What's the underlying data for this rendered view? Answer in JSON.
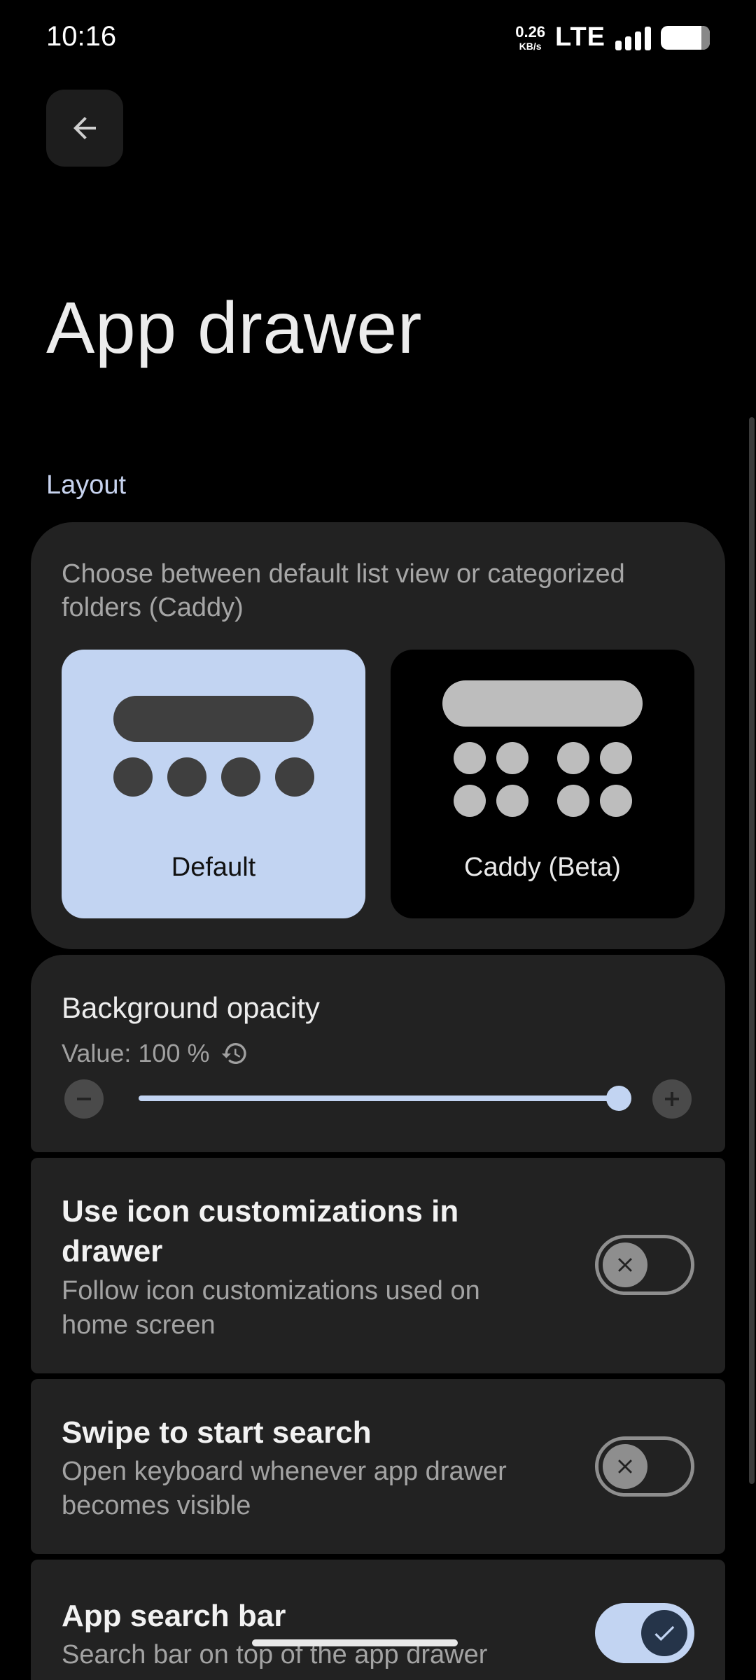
{
  "status_bar": {
    "time": "10:16",
    "net_speed_value": "0.26",
    "net_speed_unit": "KB/s",
    "network": "LTE",
    "signal_icon": "signal-bars-icon",
    "battery_icon": "battery-icon"
  },
  "header": {
    "back_icon": "arrow-left-icon",
    "title": "App drawer"
  },
  "layout_section": {
    "label": "Layout",
    "description": "Choose between default list view or categorized folders (Caddy)",
    "options": [
      {
        "label": "Default",
        "selected": true
      },
      {
        "label": "Caddy (Beta)",
        "selected": false
      }
    ]
  },
  "background_opacity": {
    "title": "Background opacity",
    "value_text": "Value: 100 %",
    "value_percent": 100,
    "reset_icon": "reset-history-icon",
    "decrease_icon": "minus-icon",
    "increase_icon": "plus-icon"
  },
  "toggles": [
    {
      "title": "Use icon customizations in drawer",
      "subtitle": "Follow icon customizations used on home screen",
      "enabled": false
    },
    {
      "title": "Swipe to start search",
      "subtitle": "Open keyboard whenever app drawer becomes visible",
      "enabled": false
    },
    {
      "title": "App search bar",
      "subtitle": "Search bar on top of the app drawer",
      "enabled": true
    }
  ],
  "colors": {
    "accent": "#c2d4f2",
    "card_bg": "#222222",
    "background": "#000000"
  }
}
